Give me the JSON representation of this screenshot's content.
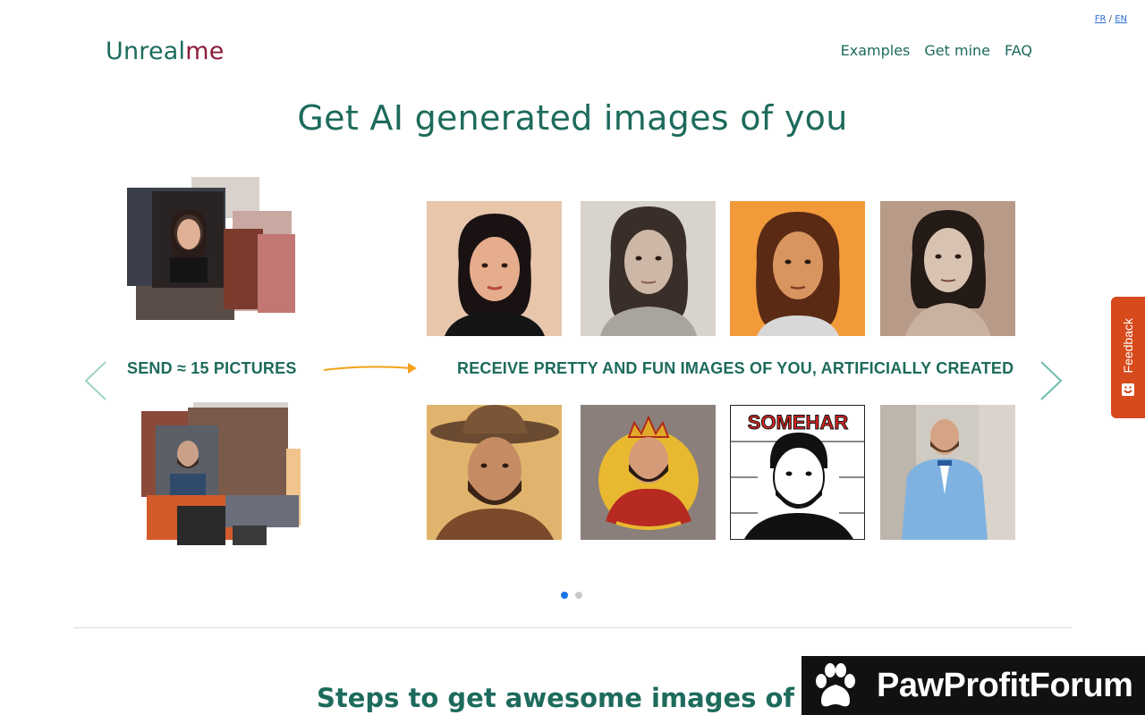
{
  "lang": {
    "fr": "FR",
    "sep": "/",
    "en": "EN"
  },
  "logo": {
    "part1": "Unreal",
    "part2": "me"
  },
  "nav": [
    {
      "label": "Examples"
    },
    {
      "label": "Get mine"
    },
    {
      "label": "FAQ"
    }
  ],
  "hero": {
    "title": "Get AI generated images of you"
  },
  "captions": {
    "send": "SEND ≈ 15 PICTURES",
    "receive": "RECEIVE PRETTY AND FUN IMAGES OF YOU, ARTIFICIALLY CREATED"
  },
  "portraits": {
    "row1": [
      {
        "name": "woman-portrait-peach",
        "bg": "#e8c6ac"
      },
      {
        "name": "woman-portrait-sketch",
        "bg": "#d8d4cc"
      },
      {
        "name": "woman-portrait-orange",
        "bg": "#f29a3a"
      },
      {
        "name": "woman-portrait-bronze",
        "bg": "#b89a88"
      }
    ],
    "row2": [
      {
        "name": "man-cowboy-portrait",
        "bg": "#e0b46c"
      },
      {
        "name": "man-king-illustration",
        "bg": "#8a7f7a"
      },
      {
        "name": "man-comic-cover",
        "bg": "#ffffff"
      },
      {
        "name": "man-blue-suit-photo",
        "bg": "#cfcac2"
      }
    ],
    "comic_label": "SOMEHAR"
  },
  "carousel": {
    "slides": 2,
    "active": 0
  },
  "steps": {
    "title": "Steps to get awesome images of yoursel"
  },
  "feedback": {
    "label": "Feedback"
  },
  "banner": {
    "brand": "PawProfitForum"
  },
  "colors": {
    "brand_green": "#1d6b5c",
    "brand_red": "#8a1d3a",
    "feedback": "#d74a1c",
    "accent_arrow": "#f2a21b"
  }
}
